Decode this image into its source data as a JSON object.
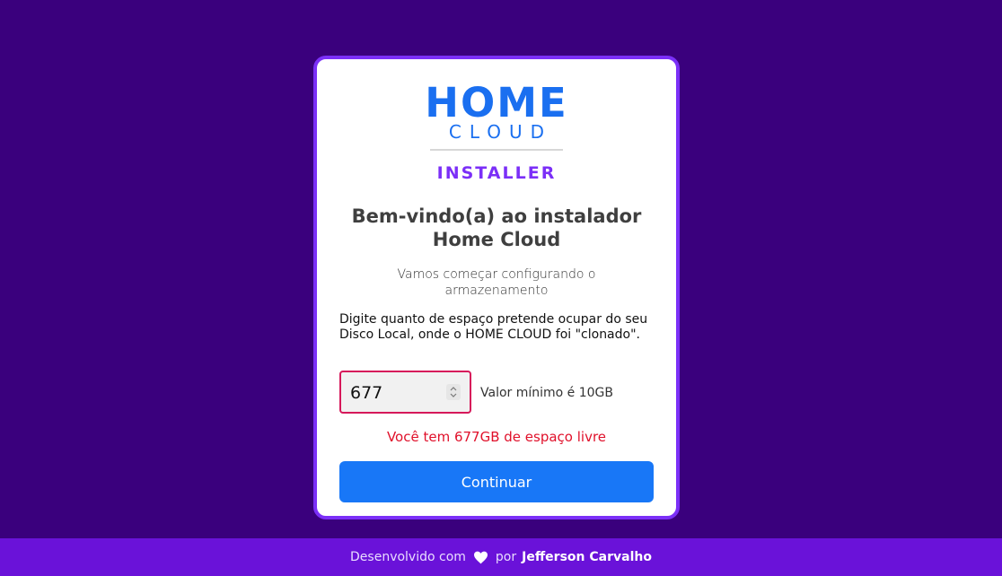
{
  "logo": {
    "home": "HOME",
    "cloud": "CLOUD",
    "installer": "INSTALLER"
  },
  "card": {
    "title_line1": "Bem-vindo(a) ao instalador",
    "title_line2": "Home Cloud",
    "subtitle": "Vamos começar configurando o armazenamento",
    "instruction": "Digite quanto de espaço pretende ocupar do seu Disco Local, onde o HOME CLOUD foi \"clonado\".",
    "storage_input_value": "677",
    "min_note": "Valor mínimo é 10GB",
    "free_space": "Você tem 677GB de espaço livre",
    "continue_label": "Continuar"
  },
  "footer": {
    "prefix": "Desenvolvido com",
    "heart_icon": "heart-icon",
    "by": "por",
    "author": "Jefferson Carvalho"
  },
  "colors": {
    "background": "#3a007d",
    "accent_purple": "#7b2ff7",
    "logo_blue": "#1a6ff0",
    "button_blue": "#1877f7",
    "error_red": "#e0102a",
    "footer_bg": "#6a12d9"
  }
}
